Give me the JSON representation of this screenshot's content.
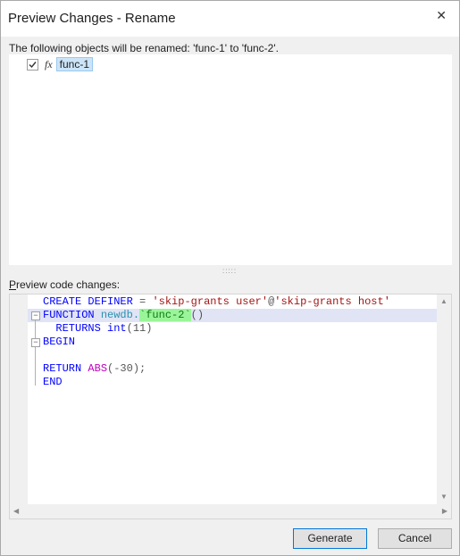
{
  "window": {
    "title": "Preview Changes - Rename",
    "close_glyph": "✕"
  },
  "objects": {
    "label": "The following objects will be renamed: 'func-1' to 'func-2'.",
    "items": [
      {
        "checked": true,
        "icon": "fx",
        "label": "func-1"
      }
    ]
  },
  "preview": {
    "label": "Preview code changes:",
    "code": {
      "create": "CREATE",
      "definer": "DEFINER",
      "eq": "=",
      "user": "'skip-grants user'",
      "at": "@",
      "host": "'skip-grants host'",
      "function": "FUNCTION",
      "db": "newdb.",
      "fname": "`func-2`",
      "parens": "()",
      "returns": "RETURNS",
      "type": "int",
      "type_args": "(11)",
      "begin": "BEGIN",
      "return": "RETURN",
      "abs": "ABS",
      "abs_args": "(-30);",
      "end": "END"
    }
  },
  "buttons": {
    "generate": "Generate",
    "cancel": "Cancel"
  },
  "colors": {
    "keyword": "#0000ff",
    "string": "#a31515",
    "highlight": "#9af59a"
  }
}
